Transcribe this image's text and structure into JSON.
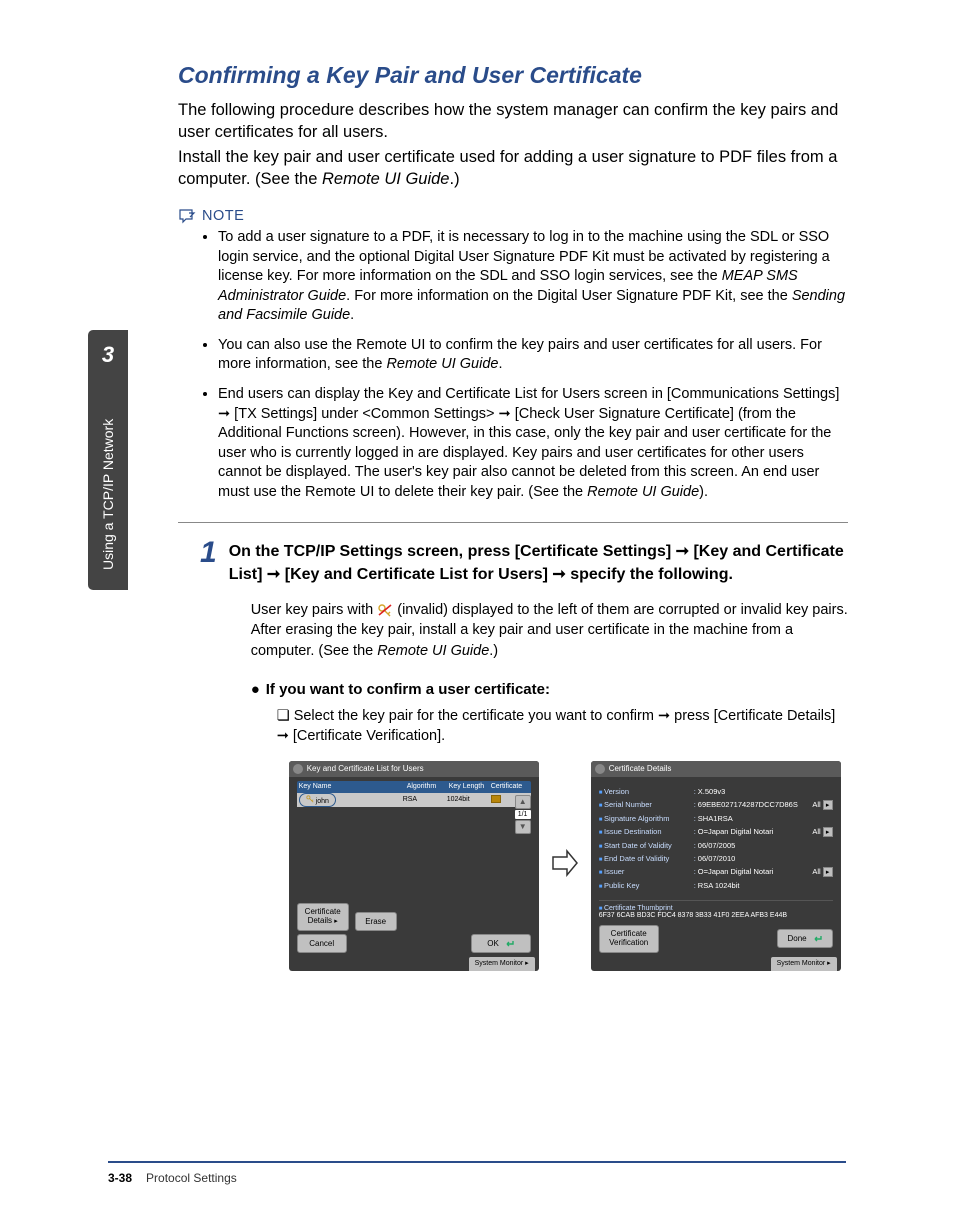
{
  "sideTab": {
    "chapterNum": "3",
    "chapterText": "Using a TCP/IP Network"
  },
  "sectionTitle": "Confirming a Key Pair and User Certificate",
  "intro1": "The following procedure describes how the system manager can confirm the key pairs and user certificates for all users.",
  "intro2a": "Install the key pair and user certificate used for adding a user signature to PDF files from a computer. (See the ",
  "intro2b": "Remote UI Guide",
  "intro2c": ".)",
  "noteLabel": "NOTE",
  "notes": {
    "n1a": "To add a user signature to a PDF, it is necessary to log in to the machine using the SDL or SSO login service, and the optional Digital User Signature PDF Kit must be activated by registering a license key. For more information on the SDL and SSO login services, see the ",
    "n1b": "MEAP SMS Administrator Guide",
    "n1c": ". For more information on the Digital User Signature PDF Kit, see the ",
    "n1d": "Sending and Facsimile Guide",
    "n1e": ".",
    "n2a": "You can also use the Remote UI to confirm the key pairs and user certificates for all users. For more information, see the ",
    "n2b": "Remote UI Guide",
    "n2c": ".",
    "n3a": "End users can display the Key and Certificate List for Users screen in [Communications Settings] ➞ [TX Settings] under <Common Settings> ➞ [Check User Signature Certificate] (from the Additional Functions screen). However, in this case, only the key pair and user certificate for the user who is currently logged in are displayed. Key pairs and user certificates for other users cannot be displayed. The user's key pair also cannot be deleted from this screen. An end user must use the Remote UI to delete their key pair. (See the ",
    "n3b": "Remote UI Guide",
    "n3c": ")."
  },
  "step": {
    "num": "1",
    "title": "On the TCP/IP Settings screen, press [Certificate Settings] ➞ [Key and Certificate List] ➞ [Key and Certificate List for Users] ➞ specify the following.",
    "desc_a": "User key pairs with ",
    "desc_b": " (invalid) displayed to the left of them are corrupted or invalid key pairs. After erasing the key pair, install a key pair and user certificate in the machine from a computer. (See the ",
    "desc_c": "Remote UI Guide",
    "desc_d": ".)"
  },
  "subBullet": "If you want to confirm a user certificate:",
  "checklist": "Select the key pair for the certificate you want to confirm ➞ press [Certificate Details] ➞ [Certificate Verification].",
  "screen1": {
    "title": "Key and Certificate List for Users",
    "col1": "Key Name",
    "col2": "Algorithm",
    "col3": "Key Length",
    "col4": "Certificate",
    "row_name": "john",
    "row_alg": "RSA",
    "row_len": "1024bit",
    "pageCount": "1/1",
    "certDetails": "Certificate Details",
    "erase": "Erase",
    "cancel": "Cancel",
    "ok": "OK",
    "sysmon": "System Monitor"
  },
  "screen2": {
    "title": "Certificate Details",
    "rows": [
      {
        "label": "Version",
        "value": "X.509v3",
        "expand": false
      },
      {
        "label": "Serial Number",
        "value": "69EBE027174287DCC7D86S",
        "expand": true
      },
      {
        "label": "Signature Algorithm",
        "value": "SHA1RSA",
        "expand": false
      },
      {
        "label": "Issue Destination",
        "value": "O=Japan Digital Notari",
        "expand": true
      },
      {
        "label": "Start Date of Validity",
        "value": "06/07/2005",
        "expand": false
      },
      {
        "label": "End Date of Validity",
        "value": "06/07/2010",
        "expand": false
      },
      {
        "label": "Issuer",
        "value": "O=Japan Digital Notari",
        "expand": true
      },
      {
        "label": "Public Key",
        "value": "RSA  1024bit",
        "expand": false
      }
    ],
    "thumbLabel": "Certificate Thumbprint",
    "thumbValue": "6F37 6CAB BD3C FDC4 8378 3B33 41F0 2EEA AFB3 E44B",
    "certVerify": "Certificate Verification",
    "done": "Done",
    "all": "All",
    "sysmon": "System Monitor"
  },
  "footer": {
    "pageNum": "3-38",
    "text": "Protocol Settings"
  }
}
